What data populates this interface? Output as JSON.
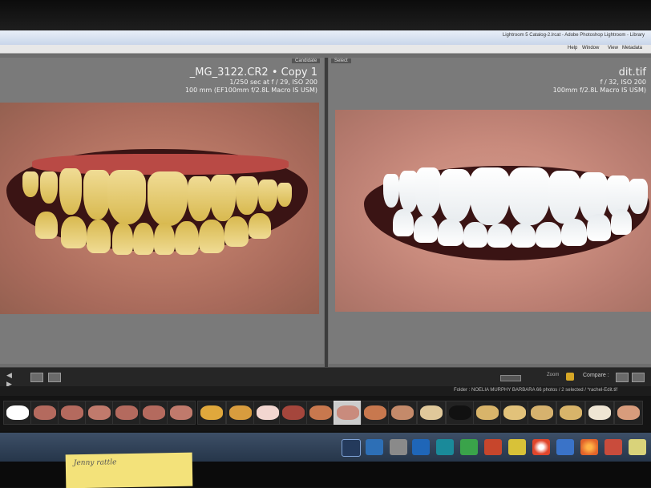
{
  "window": {
    "title": "Lightroom 5 Catalog-2.lrcat - Adobe Photoshop Lightroom - Library"
  },
  "menu": [
    "Help",
    "Window",
    "View",
    "Metadata"
  ],
  "left_pane": {
    "tag": "Candidate",
    "filename": "_MG_3122.CR2 • Copy 1",
    "exposure": "1/250 sec at f / 29, ISO 200",
    "lens": "100 mm (EF100mm f/2.8L Macro IS USM)"
  },
  "right_pane": {
    "tag": "Select",
    "filename": "dit.tif",
    "exposure": "f / 32, ISO 200",
    "lens": "100mm f/2.8L Macro IS USM)"
  },
  "toolbar": {
    "compare_label": "Compare :",
    "zoom_label": "Zoom"
  },
  "filmstrip_info": {
    "text": "Folder : NOELIA MURPHY BARBARA  66 photos / 2 selected / *rachel-Edit.tif"
  },
  "sticky_note": {
    "text": "Jenny rattle"
  },
  "colors": {
    "lr_panel": "#7a7a7a",
    "lr_dark": "#262626",
    "taskbar": "#33455d",
    "sticky": "#f3e27a"
  },
  "icons": [
    "grid-view-icon",
    "loupe-view-icon",
    "compare-view-icon",
    "survey-view-icon",
    "zoom-slider-icon",
    "start-orb-icon",
    "lightroom-icon",
    "explorer-icon",
    "chrome-icon",
    "firefox-icon",
    "outlook-icon"
  ]
}
